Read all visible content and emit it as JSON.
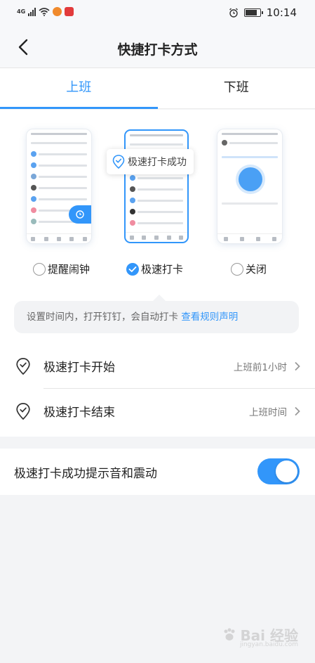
{
  "status_bar": {
    "network": "4G",
    "time": "10:14"
  },
  "nav": {
    "title": "快捷打卡方式"
  },
  "tabs": [
    {
      "label": "上班",
      "active": true
    },
    {
      "label": "下班",
      "active": false
    }
  ],
  "preview": {
    "toast_text": "极速打卡成功"
  },
  "options": [
    {
      "label": "提醒闹钟",
      "selected": false
    },
    {
      "label": "极速打卡",
      "selected": true
    },
    {
      "label": "关闭",
      "selected": false
    }
  ],
  "info": {
    "text": "设置时间内，打开钉钉，会自动打卡 ",
    "link": "查看规则声明"
  },
  "settings": [
    {
      "label": "极速打卡开始",
      "value": "上班前1小时"
    },
    {
      "label": "极速打卡结束",
      "value": "上班时间"
    }
  ],
  "toggle": {
    "label": "极速打卡成功提示音和震动",
    "on": true
  },
  "watermark": {
    "text": "Bai 经验",
    "sub": "jingyan.baidu.com"
  },
  "colors": {
    "accent": "#3296fa",
    "background": "#f3f4f6"
  }
}
